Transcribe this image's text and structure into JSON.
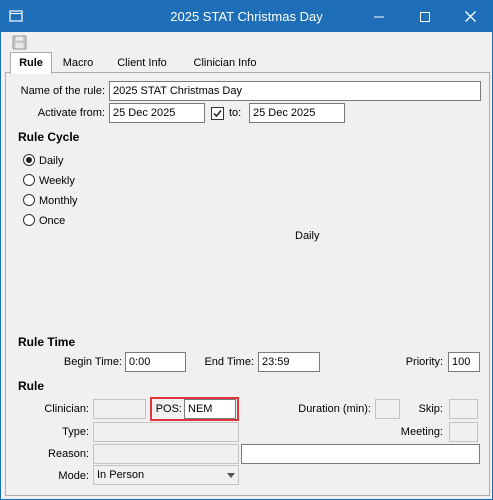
{
  "window": {
    "title": "2025 STAT Christmas Day"
  },
  "tabs": [
    {
      "label": "Rule"
    },
    {
      "label": "Macro"
    },
    {
      "label": "Client Info"
    },
    {
      "label": "Clinician Info"
    }
  ],
  "rule": {
    "name_label": "Name of the rule:",
    "name_value": "2025 STAT Christmas Day",
    "activate_from_label": "Activate from:",
    "activate_from_value": "25 Dec 2025",
    "to_label": "to:",
    "to_value": "25 Dec 2025",
    "to_checked": true
  },
  "rule_cycle": {
    "heading": "Rule Cycle",
    "options": [
      {
        "label": "Daily",
        "selected": true
      },
      {
        "label": "Weekly",
        "selected": false
      },
      {
        "label": "Monthly",
        "selected": false
      },
      {
        "label": "Once",
        "selected": false
      }
    ],
    "summary": "Daily"
  },
  "rule_time": {
    "heading": "Rule Time",
    "begin_label": "Begin Time:",
    "begin_value": "0:00",
    "end_label": "End Time:",
    "end_value": "23:59",
    "priority_label": "Priority:",
    "priority_value": "100"
  },
  "rule_detail": {
    "heading": "Rule",
    "clinician_label": "Clinician:",
    "clinician_value": "",
    "pos_label": "POS:",
    "pos_value": "NEM",
    "duration_label": "Duration (min):",
    "duration_value": "",
    "skip_label": "Skip:",
    "skip_value": "",
    "type_label": "Type:",
    "type_value": "",
    "meeting_label": "Meeting:",
    "meeting_value": "",
    "reason_label": "Reason:",
    "reason_value": "",
    "reason_extra_value": "",
    "mode_label": "Mode:",
    "mode_value": "In Person"
  },
  "colors": {
    "titlebar": "#1f6fb8",
    "highlight": "#e0353b"
  }
}
